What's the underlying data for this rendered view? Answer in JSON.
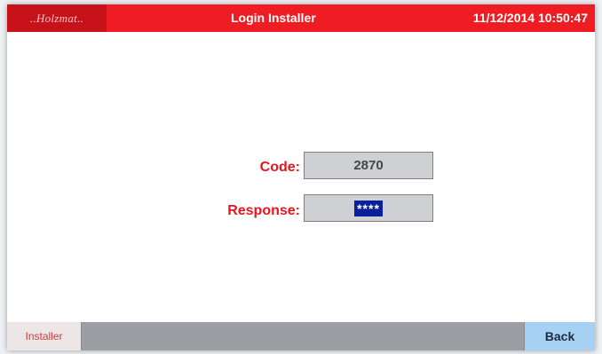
{
  "header": {
    "logo_text": "..Holzmat..",
    "title": "Login Installer",
    "datetime": "11/12/2014 10:50:47"
  },
  "form": {
    "code_label": "Code:",
    "code_value": "2870",
    "response_label": "Response:",
    "response_value": "****"
  },
  "footer": {
    "installer_label": "Installer",
    "back_label": "Back"
  },
  "colors": {
    "header_red": "#ef1d23",
    "label_red": "#e8151c",
    "field_gray": "#cfd0d3",
    "mask_blue": "#0a1f9c",
    "back_blue": "#a6d1f3"
  }
}
